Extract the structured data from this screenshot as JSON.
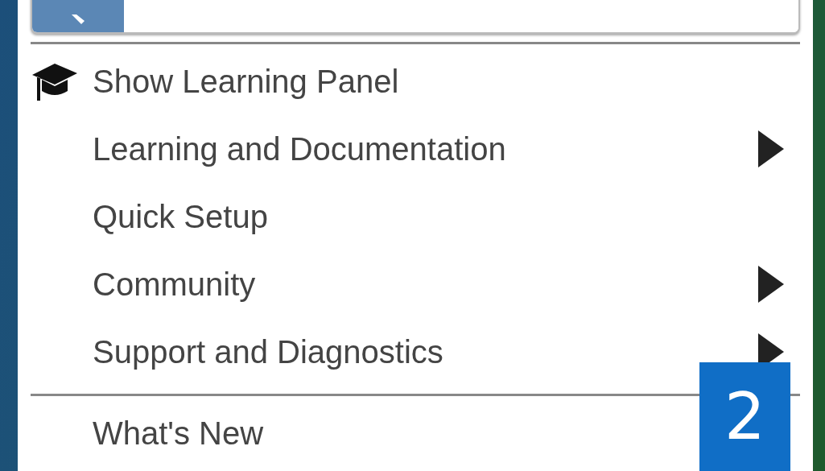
{
  "menu": {
    "sections": [
      [
        {
          "kind": "icon",
          "label": "Show Learning Panel",
          "submenu": false
        },
        {
          "kind": "plain",
          "label": "Learning and Documentation",
          "submenu": true
        },
        {
          "kind": "plain",
          "label": "Quick Setup",
          "submenu": false
        },
        {
          "kind": "plain",
          "label": "Community",
          "submenu": true
        },
        {
          "kind": "plain",
          "label": "Support and Diagnostics",
          "submenu": true
        }
      ],
      [
        {
          "kind": "plain",
          "label": "What's New",
          "submenu": false
        }
      ]
    ]
  },
  "step_badge": "2"
}
